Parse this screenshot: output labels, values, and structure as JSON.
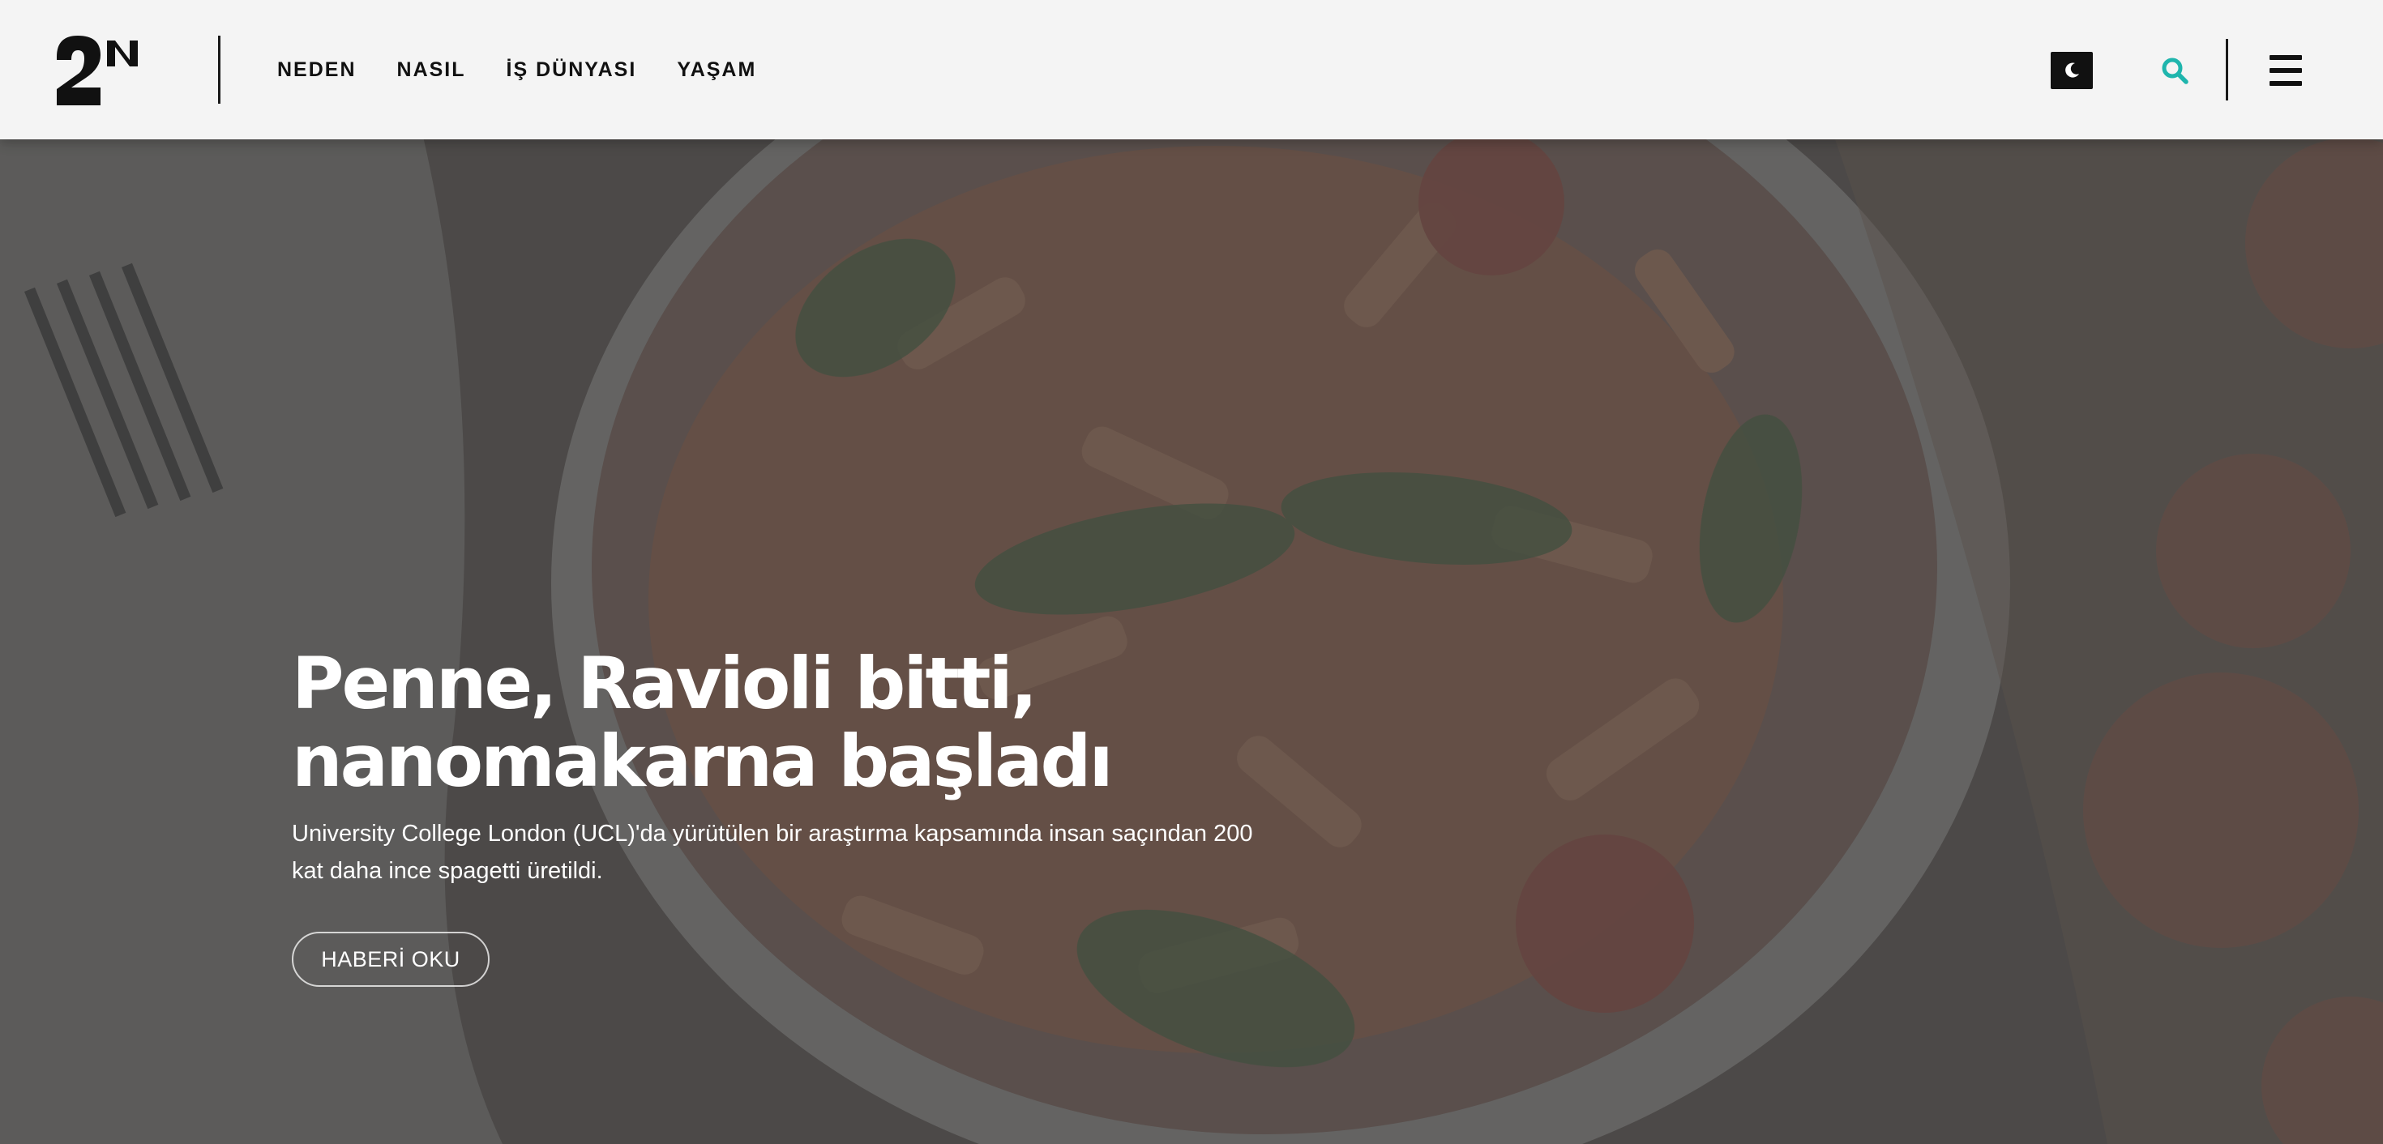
{
  "header": {
    "logo_text": "2N",
    "nav": [
      {
        "label": "NEDEN"
      },
      {
        "label": "NASIL"
      },
      {
        "label": "İŞ DÜNYASI"
      },
      {
        "label": "YAŞAM"
      }
    ],
    "icons": {
      "theme": "moon-icon",
      "search": "search-icon",
      "menu": "hamburger-menu-icon"
    }
  },
  "hero": {
    "title_line1": "Penne, Ravioli bitti,",
    "title_line2": "nanomakarna başladı",
    "subtitle": "University College London (UCL)'da yürütülen bir araştırma kapsamında insan saçından 200 kat daha ince spagetti üretildi.",
    "button_label": "HABERİ OKU"
  },
  "colors": {
    "header_bg": "#f4f4f4",
    "nav_text": "#111111",
    "accent": "#1fb5ad",
    "hero_text": "#ffffff"
  }
}
